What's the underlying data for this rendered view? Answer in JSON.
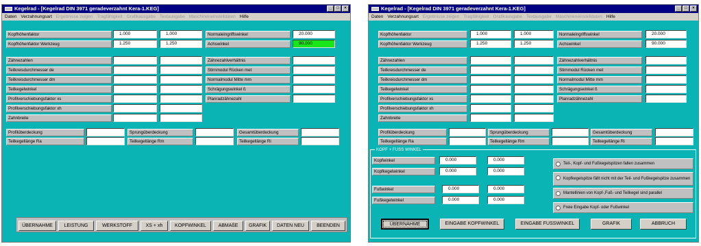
{
  "window": {
    "title": "Kegelrad - [Kegelrad DIN 3971 geradeverzahnt Kera-1.KEG]",
    "controls": [
      "_",
      "□",
      "×"
    ]
  },
  "menu": {
    "items": [
      {
        "label": "Daten",
        "enabled": true
      },
      {
        "label": "Verzahnungsart",
        "enabled": true
      },
      {
        "label": "Ergebnisse zeigen",
        "enabled": false
      },
      {
        "label": "Tragfähigkeit",
        "enabled": false
      },
      {
        "label": "Grafikausgabe",
        "enabled": false
      },
      {
        "label": "Textausgabe",
        "enabled": false
      },
      {
        "label": "Maschineneinstelldaten",
        "enabled": false
      },
      {
        "label": "Hilfe",
        "enabled": true
      }
    ]
  },
  "form": {
    "labels": {
      "kopfhoehenfaktor": "Kopfhöhenfaktor",
      "kopfhoehenfaktor_werkzeug": "Kopfhöhenfaktor Werkzeug",
      "zaehnezahlen": "Zähnezahlen",
      "teilkreisdurchmesser_de": "Teilkreisdurchmesser     de",
      "teilkreisdurchmesser_dm": "Teilkreisdurchmesser     dm",
      "teilkegelwinkel": "Teilkegelwinkel",
      "profilverschiebungsfaktor_xs": "Profilverschiebungsfaktor xs",
      "profilverschiebungsfaktor_xh": "Profilverschiebungsfaktor xh",
      "zahnbreite": "Zahnbreite",
      "normaleingriffswinkel": "Normaleingriffswinkel",
      "achswinkel": "Achswinkel",
      "zaehnezahlverhaeltnis": "Zähnezahlverhältnis",
      "stirnmodul_ruecken": "Stirnmodul  Rücken        met",
      "normalmodul_mitte": "Normalmodul Mitte         mm",
      "schraegungswinkel": "Schrägungswinkel          ß",
      "planradzaehnezahl": "Planradzähnezahl",
      "profilueberdeckung": "Profilüberdeckung",
      "teilkegellaenge_ra": "Teilkegellänge  Ra",
      "sprungueberdeckung": "Sprungüberdeckung",
      "teilkegellaenge_rm": "Teilkegellänge  Rm",
      "gesamtueberdeckung": "Gesamtüberdeckung",
      "teilkegellaenge_ri": "Teilkegellänge  Ri"
    },
    "values": {
      "kopfhoehenfaktor_1": "1.000",
      "kopfhoehenfaktor_2": "1.000",
      "kopfhoehenfaktor_werkzeug_1": "1.250",
      "kopfhoehenfaktor_werkzeug_2": "1.250",
      "normaleingriffswinkel": "20.000",
      "achswinkel": "90.000"
    },
    "highlight_color": "#19e619"
  },
  "left_buttons": [
    "ÜBERNAHME",
    "LEISTUNG",
    "WERKSTOFF",
    "XS + xh",
    "KOPFWINKEL",
    "ABMAßE",
    "GRAFIK",
    "DATEN NEU",
    "BEENDEN"
  ],
  "kopf_group": {
    "title": "KOPF + FUSS WINKEL",
    "labels": {
      "kopfwinkel": "Kopfwinkel",
      "kopfkegelwinkel": "Kopfkegelwinkel",
      "fusswinkel": "Fußwinkel",
      "fusskegelwinkel": "Fußkegelwinkel"
    },
    "values": {
      "kopfwinkel_1": "0.000",
      "kopfwinkel_2": "0.000",
      "kopfkegelwinkel_1": "0.000",
      "kopfkegelwinkel_2": "0.000",
      "fusswinkel_1": "0.000",
      "fusswinkel_2": "0.000",
      "fusskegelwinkel_1": "0.000",
      "fusskegelwinkel_2": "0.000"
    },
    "options": [
      "Teil-, Kopf- und Fußkegelspitzen fallen zusammen",
      "Kopfkegelspitze fällt nicht mit der Teil- und Fußkegelspitze zusammen",
      "Mantellinien von Kopf-,Fuß- und Teilkegel sind parallel",
      "Freie Eingabe Kopf- oder Fußwinkel"
    ]
  },
  "right_buttons": [
    "ÜBERNAHME",
    "EINGABE KOPFWINKEL",
    "EINGABE FUSSWINKEL",
    "GRAFIK",
    "ABBRUCH"
  ]
}
